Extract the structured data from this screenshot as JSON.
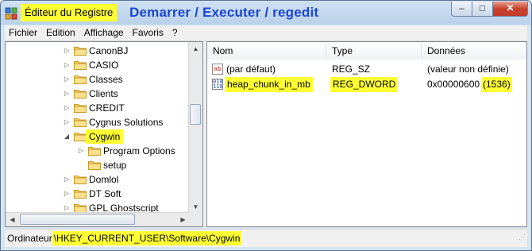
{
  "window": {
    "title": "Éditeur du Registre",
    "overlay_caption": "Demarrer / Executer / regedit"
  },
  "menu": [
    "Fichier",
    "Edition",
    "Affichage",
    "Favoris",
    "?"
  ],
  "tree": {
    "items": [
      {
        "label": "CanonBJ",
        "expander": "collapsed"
      },
      {
        "label": "CASIO",
        "expander": "collapsed"
      },
      {
        "label": "Classes",
        "expander": "collapsed"
      },
      {
        "label": "Clients",
        "expander": "collapsed"
      },
      {
        "label": "CREDIT",
        "expander": "collapsed"
      },
      {
        "label": "Cygnus Solutions",
        "expander": "collapsed"
      },
      {
        "label": "Cygwin",
        "expander": "expanded",
        "selected": true
      },
      {
        "label": "Program Options",
        "expander": "collapsed",
        "child": true
      },
      {
        "label": "setup",
        "expander": "none",
        "child": true
      },
      {
        "label": "Domlol",
        "expander": "collapsed"
      },
      {
        "label": "DT Soft",
        "expander": "collapsed"
      },
      {
        "label": "GPL Ghostscript",
        "expander": "collapsed"
      }
    ]
  },
  "values": {
    "columns": [
      "Nom",
      "Type",
      "Données"
    ],
    "rows": [
      {
        "icon": "string-value-icon",
        "name": "(par défaut)",
        "type": "REG_SZ",
        "data": "(valeur non définie)"
      },
      {
        "icon": "binary-value-icon",
        "name": "heap_chunk_in_mb",
        "type": "REG_DWORD",
        "data_hex": "0x00000600",
        "data_dec": "(1536)"
      }
    ]
  },
  "status": {
    "prefix": "Ordinateur",
    "path": "\\HKEY_CURRENT_USER\\Software\\Cygwin"
  },
  "colors": {
    "highlight": "#ffff33",
    "caption_text": "#1a45d6"
  }
}
